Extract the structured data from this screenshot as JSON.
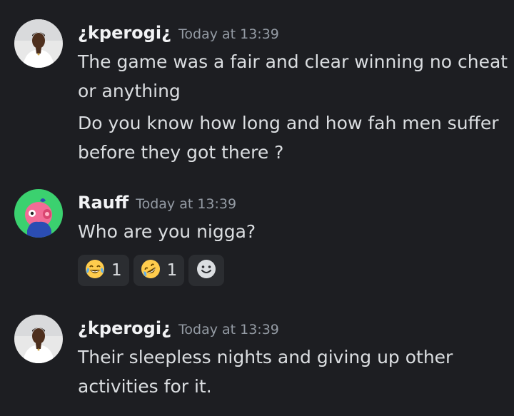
{
  "messages": [
    {
      "username": "¿kperogi¿",
      "timestamp": "Today at 13:39",
      "lines": [
        "The game was a fair and clear winning no cheat",
        "or anything",
        "Do you know how long and how fah men suffer",
        "before they got there ?"
      ]
    },
    {
      "username": "Rauff",
      "timestamp": "Today at 13:39",
      "lines": [
        "Who are you nigga?"
      ],
      "reactions": [
        {
          "emoji": "joy-emoji",
          "count": "1"
        },
        {
          "emoji": "rofl-emoji",
          "count": "1"
        }
      ],
      "add_reaction_icon": "smiley-add-reaction-icon"
    },
    {
      "username": "¿kperogi¿",
      "timestamp": "Today at 13:39",
      "lines": [
        "Their sleepless nights and giving up other",
        "activities for it."
      ]
    }
  ],
  "colors": {
    "background": "#1d1e22",
    "username": "#f2f3f5",
    "timestamp": "#949ba4",
    "text": "#dbdee1",
    "reaction_bg": "#2b2d31",
    "rauff_avatar_bg": "#3bd16f"
  }
}
